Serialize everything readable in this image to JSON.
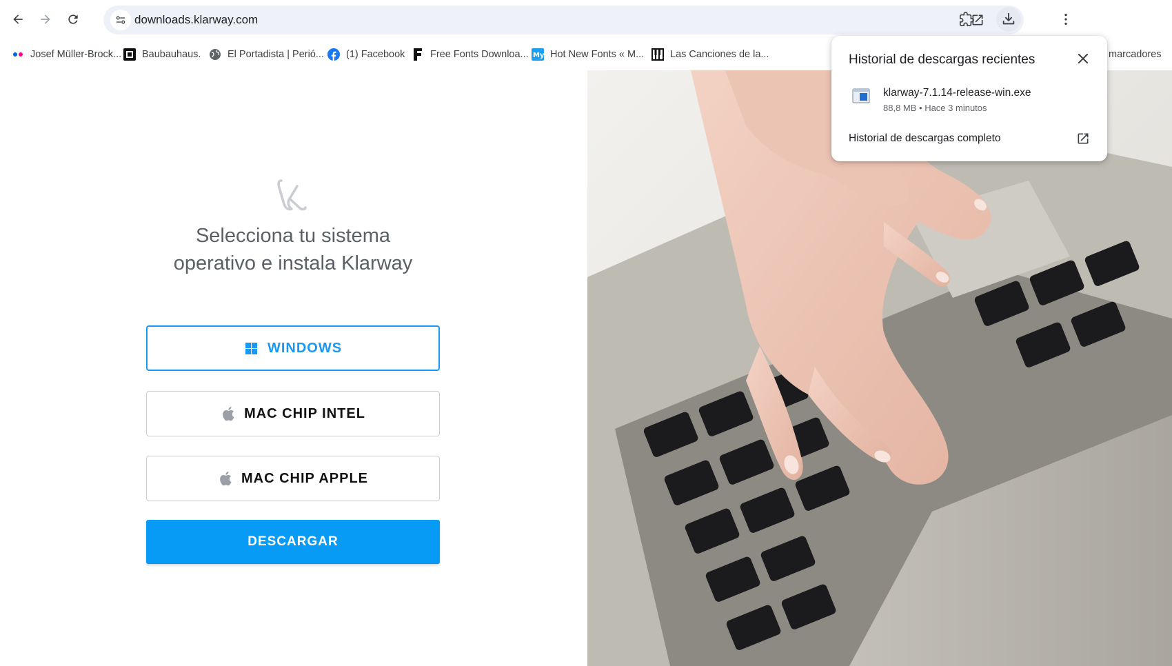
{
  "browser": {
    "url": "downloads.klarway.com"
  },
  "bookmarks": [
    {
      "label": "Josef Müller-Brock...",
      "icon": "flickr-dots-icon"
    },
    {
      "label": "Baubauhaus.",
      "icon": "baubauhaus-square-icon"
    },
    {
      "label": "El Portadista | Perió...",
      "icon": "globe-icon"
    },
    {
      "label": "(1) Facebook",
      "icon": "facebook-icon"
    },
    {
      "label": "Free Fonts Downloa...",
      "icon": "f-letter-icon"
    },
    {
      "label": "Hot New Fonts « M...",
      "icon": "myfonts-icon"
    },
    {
      "label": "Las Canciones de la...",
      "icon": "piano-icon"
    },
    {
      "label": "marcadores",
      "icon": "folder-icon"
    }
  ],
  "page": {
    "headline_line1": "Selecciona tu sistema",
    "headline_line2": "operativo e instala Klarway",
    "options": [
      {
        "label": "WINDOWS",
        "icon": "windows-icon",
        "selected": true
      },
      {
        "label": "MAC CHIP INTEL",
        "icon": "apple-icon",
        "selected": false
      },
      {
        "label": "MAC CHIP APPLE",
        "icon": "apple-icon",
        "selected": false
      }
    ],
    "download_label": "DESCARGAR",
    "colors": {
      "accent": "#079bf6",
      "selected_border": "#1a98f2"
    }
  },
  "downloads_popup": {
    "title": "Historial de descargas recientes",
    "file_name": "klarway-7.1.14-release-win.exe",
    "file_meta": "88,8 MB • Hace 3 minutos",
    "full_history_label": "Historial de descargas completo"
  }
}
